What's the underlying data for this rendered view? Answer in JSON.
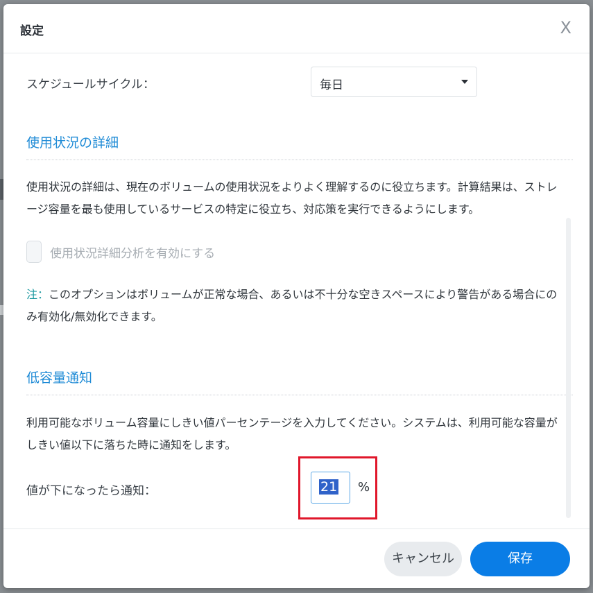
{
  "dialog": {
    "title": "設定",
    "close_label": "X"
  },
  "schedule": {
    "label": "スケジュールサイクル：",
    "selected": "毎日"
  },
  "usage_details": {
    "section_title": "使用状況の詳細",
    "description": "使用状況の詳細は、現在のボリュームの使用状況をよりよく理解するのに役立ちます。計算結果は、ストレージ容量を最も使用しているサービスの特定に役立ち、対応策を実行できるようにします。",
    "checkbox_label": "使用状況詳細分析を有効にする",
    "checkbox_checked": false,
    "note_key": "注：",
    "note_text": "このオプションはボリュームが正常な場合、あるいは不十分な空きスペースにより警告がある場合にのみ有効化/無効化できます。"
  },
  "low_capacity": {
    "section_title": "低容量通知",
    "description": "利用可能なボリューム容量にしきい値パーセンテージを入力してください。システムは、利用可能な容量がしきい値以下に落ちた時に通知をします。",
    "threshold_label": "値が下になったら通知：",
    "threshold_value": "21",
    "unit": "%"
  },
  "footer": {
    "cancel_label": "キャンセル",
    "save_label": "保存"
  },
  "colors": {
    "accent": "#0a7de6",
    "section_title": "#1f8bd6",
    "highlight_box": "#e0172b"
  }
}
